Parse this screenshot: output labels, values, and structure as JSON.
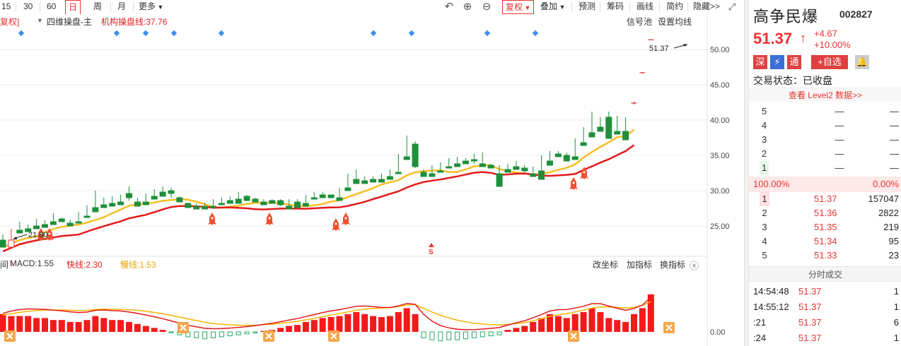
{
  "toolbar": {
    "periods": [
      "15",
      "30",
      "60",
      "日",
      "周",
      "月",
      "更多"
    ],
    "active_period": "日",
    "fuquan": "复权",
    "tools": [
      "叠加",
      "预测",
      "筹码",
      "画线",
      "简约",
      "隐藏>>"
    ]
  },
  "indicator_header": {
    "fq_tail": "复权]",
    "line1": "四维操盘-主",
    "line2_label": "机构操盘线:37.76",
    "signal_pool": "信号池",
    "set_ma": "设置均线"
  },
  "price_axis": [
    "50.00",
    "45.00",
    "40.00",
    "35.00",
    "30.00",
    "25.00"
  ],
  "annotations": {
    "high_label": "51.37",
    "low_label": "21.80",
    "s_label": "S"
  },
  "macd_header": {
    "title": "MACD:1.55",
    "fast": "快线:2.30",
    "slow": "慢线:1.53",
    "change_coord": "改坐标",
    "add_indicator": "加指标",
    "switch_indicator": "换指标",
    "zero_label": "0.00"
  },
  "quote": {
    "name": "高争民爆",
    "code": "002827",
    "price": "51.37",
    "arrow": "↑",
    "change": "+4.67",
    "change_pct": "+10.00%",
    "badges": [
      "深",
      "通",
      "+自选"
    ],
    "status": "交易状态：已收盘",
    "level2": "查看 Level2 数据>>"
  },
  "orderbook": {
    "sell": [
      {
        "level": "5",
        "price": "—",
        "vol": "—"
      },
      {
        "level": "4",
        "price": "—",
        "vol": "—"
      },
      {
        "level": "3",
        "price": "—",
        "vol": "—"
      },
      {
        "level": "2",
        "price": "—",
        "vol": "—"
      },
      {
        "level": "1",
        "price": "—",
        "vol": "—"
      }
    ],
    "ratio_left": "100.00%",
    "ratio_right": "0.00%",
    "buy": [
      {
        "level": "1",
        "price": "51.37",
        "vol": "157047"
      },
      {
        "level": "2",
        "price": "51.36",
        "vol": "2822"
      },
      {
        "level": "3",
        "price": "51.35",
        "vol": "219"
      },
      {
        "level": "4",
        "price": "51.34",
        "vol": "95"
      },
      {
        "level": "5",
        "price": "51.33",
        "vol": "23"
      }
    ]
  },
  "ticks": {
    "title": "分时成交",
    "rows": [
      {
        "time": "14:54:48",
        "price": "51.37",
        "vol": "1"
      },
      {
        "time": "14:55:12",
        "price": "51.37",
        "vol": "1"
      },
      {
        "time": ":21",
        "price": "51.37",
        "vol": "6"
      },
      {
        "time": ":24",
        "price": "51.37",
        "vol": "1"
      }
    ]
  },
  "colors": {
    "up": "#e33333",
    "down": "#1e8f3a",
    "ma_line": "#e31a1a",
    "yellow_line": "#f5b400",
    "diamond": "#3d8ff0"
  },
  "chart_data": {
    "type": "candlestick",
    "ylim": [
      21,
      53
    ],
    "candles": [
      [
        23.0,
        22.0,
        23.6,
        23.8
      ],
      [
        22.0,
        23.0,
        24.0,
        24.6
      ],
      [
        24.4,
        24.0,
        25.2,
        25.6
      ],
      [
        24.6,
        24.2,
        25.0,
        25.2
      ],
      [
        25.0,
        24.6,
        25.8,
        26.0
      ],
      [
        25.2,
        24.8,
        25.6,
        25.8
      ],
      [
        25.6,
        25.2,
        26.4,
        26.8
      ],
      [
        26.0,
        25.6,
        25.6,
        26.2
      ],
      [
        25.4,
        25.0,
        25.6,
        25.9
      ],
      [
        25.6,
        25.4,
        26.8,
        27.0
      ],
      [
        26.4,
        26.2,
        27.6,
        27.9
      ],
      [
        27.6,
        27.0,
        29.6,
        30.0
      ],
      [
        28.0,
        27.6,
        28.8,
        29.0
      ],
      [
        28.2,
        27.8,
        28.6,
        29.2
      ],
      [
        28.4,
        28.0,
        29.0,
        29.4
      ],
      [
        29.6,
        29.0,
        28.6,
        30.6
      ],
      [
        28.4,
        27.8,
        28.6,
        29.0
      ],
      [
        28.4,
        28.0,
        29.2,
        29.6
      ],
      [
        29.2,
        28.8,
        29.8,
        30.2
      ],
      [
        29.8,
        29.2,
        30.2,
        30.6
      ],
      [
        30.0,
        29.6,
        29.0,
        30.4
      ],
      [
        29.0,
        28.4,
        29.0,
        29.2
      ],
      [
        28.2,
        27.6,
        28.0,
        28.2
      ],
      [
        27.8,
        27.4,
        27.8,
        28.2
      ],
      [
        27.8,
        27.4,
        28.0,
        28.3
      ],
      [
        27.8,
        27.6,
        28.4,
        28.8
      ],
      [
        28.2,
        28.0,
        28.8,
        29.0
      ],
      [
        28.6,
        28.2,
        29.0,
        29.2
      ],
      [
        28.8,
        28.2,
        29.4,
        29.8
      ],
      [
        29.2,
        28.6,
        28.8,
        29.4
      ],
      [
        28.8,
        28.4,
        28.4,
        29.0
      ],
      [
        28.4,
        28.0,
        28.6,
        28.8
      ],
      [
        28.6,
        28.2,
        28.4,
        28.8
      ],
      [
        28.6,
        28.0,
        27.8,
        28.8
      ],
      [
        27.8,
        27.4,
        28.6,
        28.8
      ],
      [
        28.4,
        27.6,
        28.2,
        28.8
      ],
      [
        28.2,
        27.8,
        29.0,
        29.4
      ],
      [
        29.0,
        28.8,
        29.6,
        29.8
      ],
      [
        29.4,
        29.0,
        29.4,
        29.8
      ],
      [
        29.4,
        29.0,
        29.0,
        29.4
      ],
      [
        29.0,
        28.6,
        29.8,
        30.4
      ],
      [
        30.4,
        30.0,
        31.8,
        32.4
      ],
      [
        31.6,
        31.0,
        32.6,
        33.0
      ],
      [
        31.4,
        31.0,
        31.6,
        32.0
      ],
      [
        31.6,
        31.2,
        31.6,
        32.0
      ],
      [
        31.6,
        31.2,
        32.0,
        32.4
      ],
      [
        32.0,
        31.6,
        32.6,
        33.0
      ],
      [
        32.6,
        32.4,
        34.4,
        35.2
      ],
      [
        34.8,
        34.4,
        36.6,
        37.8
      ],
      [
        36.6,
        33.4,
        33.2,
        37.0
      ],
      [
        32.6,
        32.0,
        32.2,
        33.0
      ],
      [
        32.4,
        32.0,
        33.0,
        33.6
      ],
      [
        32.8,
        32.6,
        33.6,
        34.0
      ],
      [
        33.4,
        33.2,
        34.0,
        34.6
      ],
      [
        33.8,
        33.4,
        34.4,
        34.8
      ],
      [
        34.2,
        33.8,
        34.4,
        34.6
      ],
      [
        34.4,
        34.2,
        33.8,
        35.2
      ],
      [
        33.8,
        33.4,
        34.0,
        35.4
      ],
      [
        33.6,
        33.2,
        33.4,
        33.8
      ],
      [
        32.4,
        30.6,
        33.2,
        33.6
      ],
      [
        33.0,
        32.6,
        33.4,
        33.8
      ],
      [
        33.4,
        33.0,
        33.2,
        34.2
      ],
      [
        33.2,
        32.8,
        32.6,
        33.6
      ],
      [
        32.4,
        32.0,
        32.8,
        33.4
      ],
      [
        32.8,
        31.6,
        34.6,
        35.0
      ],
      [
        34.2,
        33.6,
        35.2,
        35.6
      ],
      [
        35.2,
        34.8,
        34.8,
        35.6
      ],
      [
        35.0,
        34.2,
        34.8,
        35.4
      ],
      [
        34.8,
        34.4,
        36.8,
        37.4
      ],
      [
        36.8,
        36.4,
        38.0,
        39.0
      ],
      [
        38.2,
        37.6,
        38.8,
        41.2
      ],
      [
        39.0,
        38.4,
        40.2,
        40.4
      ],
      [
        40.4,
        37.4,
        38.0,
        41.2
      ],
      [
        38.4,
        38.0,
        40.2,
        40.6
      ],
      [
        38.4,
        37.2,
        40.2,
        40.4
      ],
      [
        42.4,
        42.2,
        42.6,
        42.6
      ],
      [
        46.7,
        46.6,
        46.8,
        46.8
      ],
      [
        51.37,
        51.37,
        51.37,
        51.37
      ]
    ],
    "macd_values": [
      0.9,
      0.8,
      0.8,
      0.8,
      0.7,
      0.7,
      0.6,
      0.6,
      0.5,
      0.5,
      0.6,
      0.8,
      0.7,
      0.6,
      0.6,
      0.5,
      0.4,
      0.3,
      0.2,
      0.1,
      -0.05,
      -0.15,
      -0.25,
      -0.3,
      -0.35,
      -0.3,
      -0.25,
      -0.2,
      -0.15,
      -0.1,
      -0.05,
      0.05,
      0.1,
      0.2,
      0.3,
      0.35,
      0.5,
      0.6,
      0.7,
      0.75,
      0.8,
      0.9,
      1.0,
      0.9,
      0.8,
      0.75,
      0.8,
      1.0,
      1.2,
      0.9,
      -0.3,
      -0.4,
      -0.45,
      -0.4,
      -0.4,
      -0.35,
      -0.3,
      -0.25,
      -0.2,
      -0.15,
      0.1,
      0.2,
      0.3,
      0.5,
      0.7,
      0.9,
      0.8,
      0.7,
      0.9,
      1.0,
      1.2,
      1.0,
      0.7,
      0.6,
      0.5,
      0.9,
      1.2,
      1.9
    ]
  }
}
